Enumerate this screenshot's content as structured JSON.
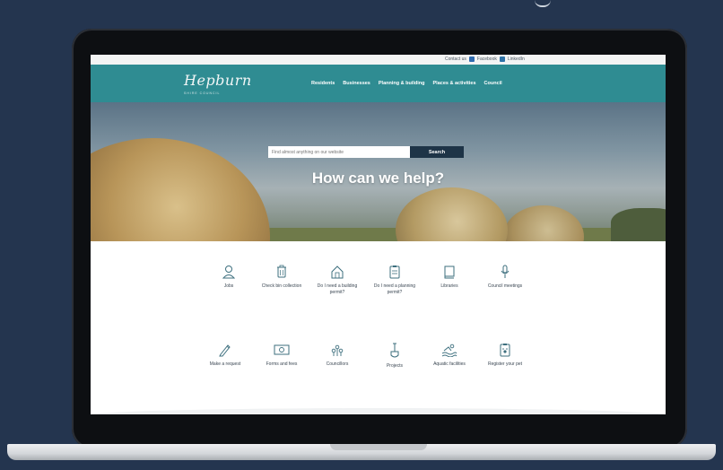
{
  "topbar": {
    "contact": "Contact us",
    "facebook": "Facebook",
    "linkedin": "LinkedIn"
  },
  "brand": {
    "logo_script": "Hepburn",
    "logo_tag": "SHIRE COUNCIL"
  },
  "nav": {
    "items": [
      "Residents",
      "Businesses",
      "Planning & building",
      "Places & activities",
      "Council"
    ]
  },
  "search": {
    "placeholder": "Find almost anything on our website",
    "button": "Search"
  },
  "hero": {
    "title": "How can we help?"
  },
  "services": {
    "row1": [
      {
        "label": "Jobs",
        "icon": "person-icon"
      },
      {
        "label": "Check bin collection",
        "icon": "bin-icon"
      },
      {
        "label": "Do I need a building permit?",
        "icon": "house-icon"
      },
      {
        "label": "Do I need a planning permit?",
        "icon": "clipboard-icon"
      },
      {
        "label": "Libraries",
        "icon": "book-icon"
      },
      {
        "label": "Council meetings",
        "icon": "microphone-icon"
      }
    ],
    "row2": [
      {
        "label": "Make a request",
        "icon": "pencil-icon"
      },
      {
        "label": "Forms and fees",
        "icon": "money-icon"
      },
      {
        "label": "Councillors",
        "icon": "people-icon"
      },
      {
        "label": "Projects",
        "icon": "shovel-icon"
      },
      {
        "label": "Aquatic facilities",
        "icon": "swimmer-icon"
      },
      {
        "label": "Register your pet",
        "icon": "pet-register-icon"
      }
    ]
  },
  "colors": {
    "nav": "#2f8c92",
    "search_button": "#1e3447",
    "background": "#24354f",
    "icon_stroke": "#3d6f7e"
  }
}
